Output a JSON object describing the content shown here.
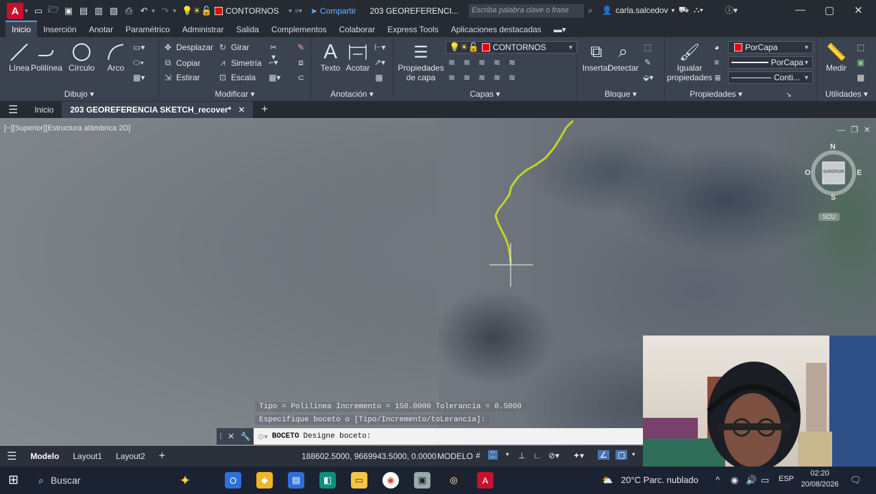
{
  "titlebar": {
    "layer_name": "CONTORNOS",
    "share_label": "Compartir",
    "document_title": "203 GEOREFERENCI...",
    "search_placeholder": "Escriba palabra clave o frase",
    "user_name": "carla.salcedov"
  },
  "menu_tabs": [
    "Inicio",
    "Inserción",
    "Anotar",
    "Paramétrico",
    "Administrar",
    "Salida",
    "Complementos",
    "Colaborar",
    "Express Tools",
    "Aplicaciones destacadas"
  ],
  "ribbon": {
    "dibujo": {
      "title": "Dibujo",
      "tools": [
        "Línea",
        "Polilínea",
        "Círculo",
        "Arco"
      ]
    },
    "modificar": {
      "title": "Modificar",
      "tools": [
        "Desplazar",
        "Girar",
        "Copiar",
        "Simetría",
        "Estirar",
        "Escala"
      ]
    },
    "anotacion": {
      "title": "Anotación",
      "tools": [
        "Texto",
        "Acotar"
      ]
    },
    "capas": {
      "title": "Capas",
      "big_tool": "Propiedades de capa",
      "layer_combo": "CONTORNOS"
    },
    "bloque": {
      "title": "Bloque",
      "tools": [
        "Insertar",
        "Detectar"
      ]
    },
    "propiedades": {
      "title": "Propiedades",
      "big_tool": "Igualar propiedades",
      "color": "PorCapa",
      "linetype": "PorCapa",
      "lineweight": "Conti..."
    },
    "utilidades": {
      "title": "Utilidades",
      "tool": "Medir"
    }
  },
  "file_tabs": {
    "home": "Inicio",
    "active": "203 GEOREFERENCIA SKETCH_recover*"
  },
  "viewport": {
    "label": "[−][Superior][Estructura alámbrica 2D]",
    "viewcube": {
      "n": "N",
      "s": "S",
      "e": "E",
      "w": "O",
      "face": "SUPERIOR",
      "ucs": "SCU"
    },
    "history_line1": "Tipo = Polilínea Incremento = 150.0000 Tolerancia = 0.5000",
    "history_line2": "Especifique boceto o [Tipo/Incremento/toLerancia]:"
  },
  "command_line": {
    "command": "BOCETO",
    "prompt": "Designe boceto:"
  },
  "statusbar": {
    "tabs": [
      "Modelo",
      "Layout1",
      "Layout2"
    ],
    "coordinates": "188602.5000, 9669943.5000, 0.0000",
    "space": "MODELO"
  },
  "taskbar": {
    "search_label": "Buscar",
    "weather": "20°C  Parc. nublado",
    "language": "ESP",
    "time": "02:20",
    "date": "20/08/2026"
  },
  "colors": {
    "accent": "#4aa3ff",
    "sketch_line": "#c3d42a",
    "layer_red": "#e00000"
  }
}
